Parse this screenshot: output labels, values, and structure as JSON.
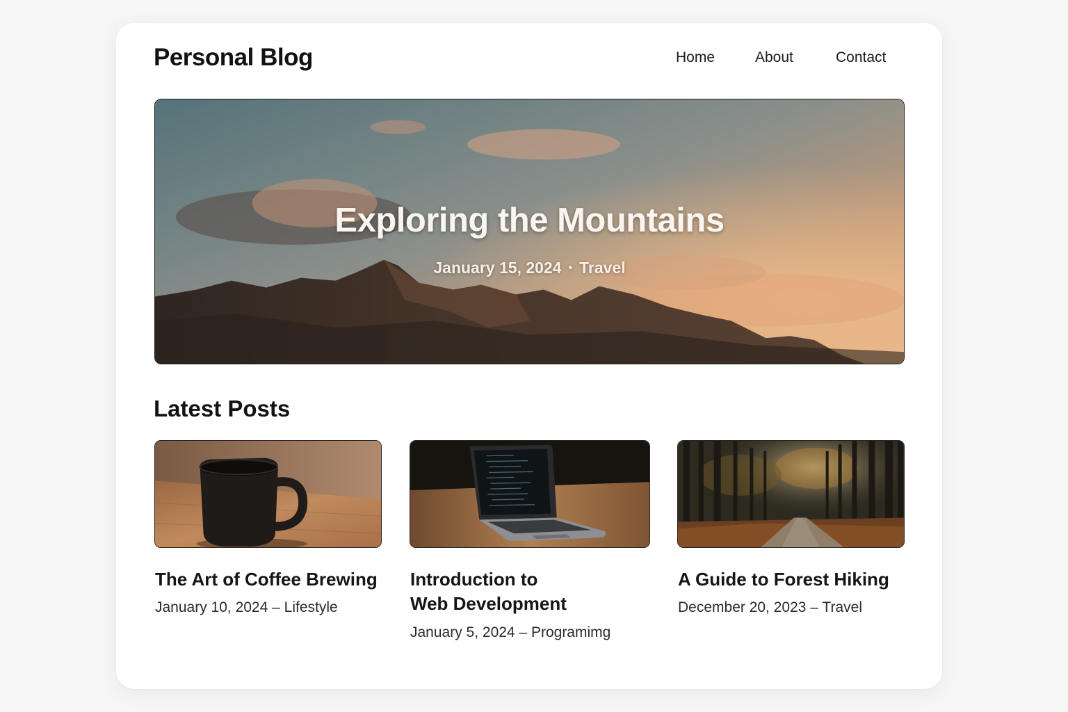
{
  "site": {
    "brand": "Personal Blog"
  },
  "nav": {
    "items": [
      "Home",
      "About",
      "Contact"
    ]
  },
  "hero": {
    "title": "Exploring the Mountains",
    "date": "January 15, 2024",
    "separator": "•",
    "category": "Travel"
  },
  "latest": {
    "heading": "Latest Posts",
    "posts": [
      {
        "title_line1": "The Art of Coffee Brewing",
        "title_line2": "",
        "meta": "January 10, 2024 – Lifestyle",
        "image": "coffee-mug"
      },
      {
        "title_line1": "Introduction to",
        "title_line2": "Web Development",
        "meta": "January 5, 2024 – Programimg",
        "image": "laptop"
      },
      {
        "title_line1": "A Guide to Forest Hiking",
        "title_line2": "",
        "meta": "December 20, 2023 – Travel",
        "image": "forest-path"
      }
    ]
  },
  "colors": {
    "page_bg": "#f6f6f6",
    "card_bg": "#ffffff",
    "text": "#151515"
  }
}
